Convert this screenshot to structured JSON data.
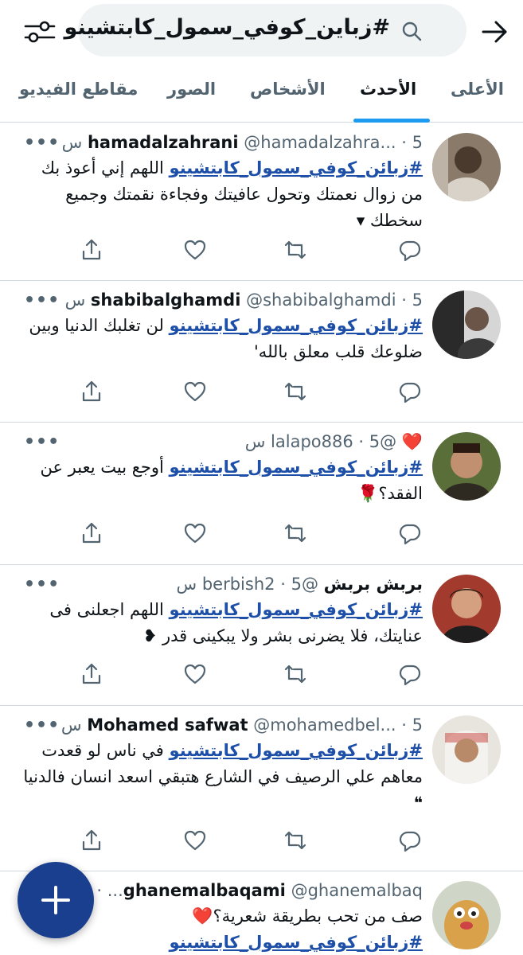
{
  "search": {
    "query": "#زباين_كوفي_سمول_كابتشينو"
  },
  "tabs": [
    {
      "label": "الأعلى"
    },
    {
      "label": "الأحدث"
    },
    {
      "label": "الأشخاص"
    },
    {
      "label": "الصور"
    },
    {
      "label": "مقاطع الفيديو"
    }
  ],
  "active_tab": "الأحدث",
  "tweets": [
    {
      "name": "hamadalzahrani",
      "handle": "@hamadalzahra...",
      "time": "5 س",
      "hashtag": "#زبائن_كوفي_سمول_كابتشينو",
      "text": " اللهم إني أعوذ بك من زوال نعمتك وتحول عافيتك وفجاءة نقمتك وجميع سخطك ▾"
    },
    {
      "name": "shabibalghamdi",
      "handle": "@shabibalghamdi",
      "time": "5 س",
      "hashtag": "#زبائن_كوفي_سمول_كابتشينو",
      "text": " لن تغلبك الدنيا وبين ضلوعك قلب معلق بالله'"
    },
    {
      "name": "❤️",
      "handle": "@lalapo886",
      "time": "5 س",
      "hashtag": "#زبائن_كوفي_سمول_كابتشينو",
      "text": " أوجع بيت يعبر عن الفقد؟🌹"
    },
    {
      "name": "بربش بربش",
      "handle": "@berbish2",
      "time": "5 س",
      "hashtag": "#زبائن_كوفي_سمول_كابتشينو",
      "text": " اللهم اجعلنى فى عنايتك، فلا يضرنى بشر ولا يبكينى قدر ❥"
    },
    {
      "name": "Mohamed safwat",
      "handle": "@mohamedbel...",
      "time": "5 س",
      "hashtag": "#زبائن_كوفي_سمول_كابتشينو",
      "text": " في ناس لو قعدت معاهم علي الرصيف في الشارع هتبقي اسعد انسان فالدنيا ❝"
    },
    {
      "name": "ghanemalbaqami",
      "handle": "@ghanemalbaq...",
      "time": "",
      "hashtag": "#زبائن_كوفي_سمول_كابتشينو",
      "text": "صف من تحب بطريقة شعرية؟❤️"
    }
  ],
  "colors": {
    "accent": "#1d9bf0",
    "hashtag": "#1d4fa8",
    "fab": "#1a3f8f"
  }
}
